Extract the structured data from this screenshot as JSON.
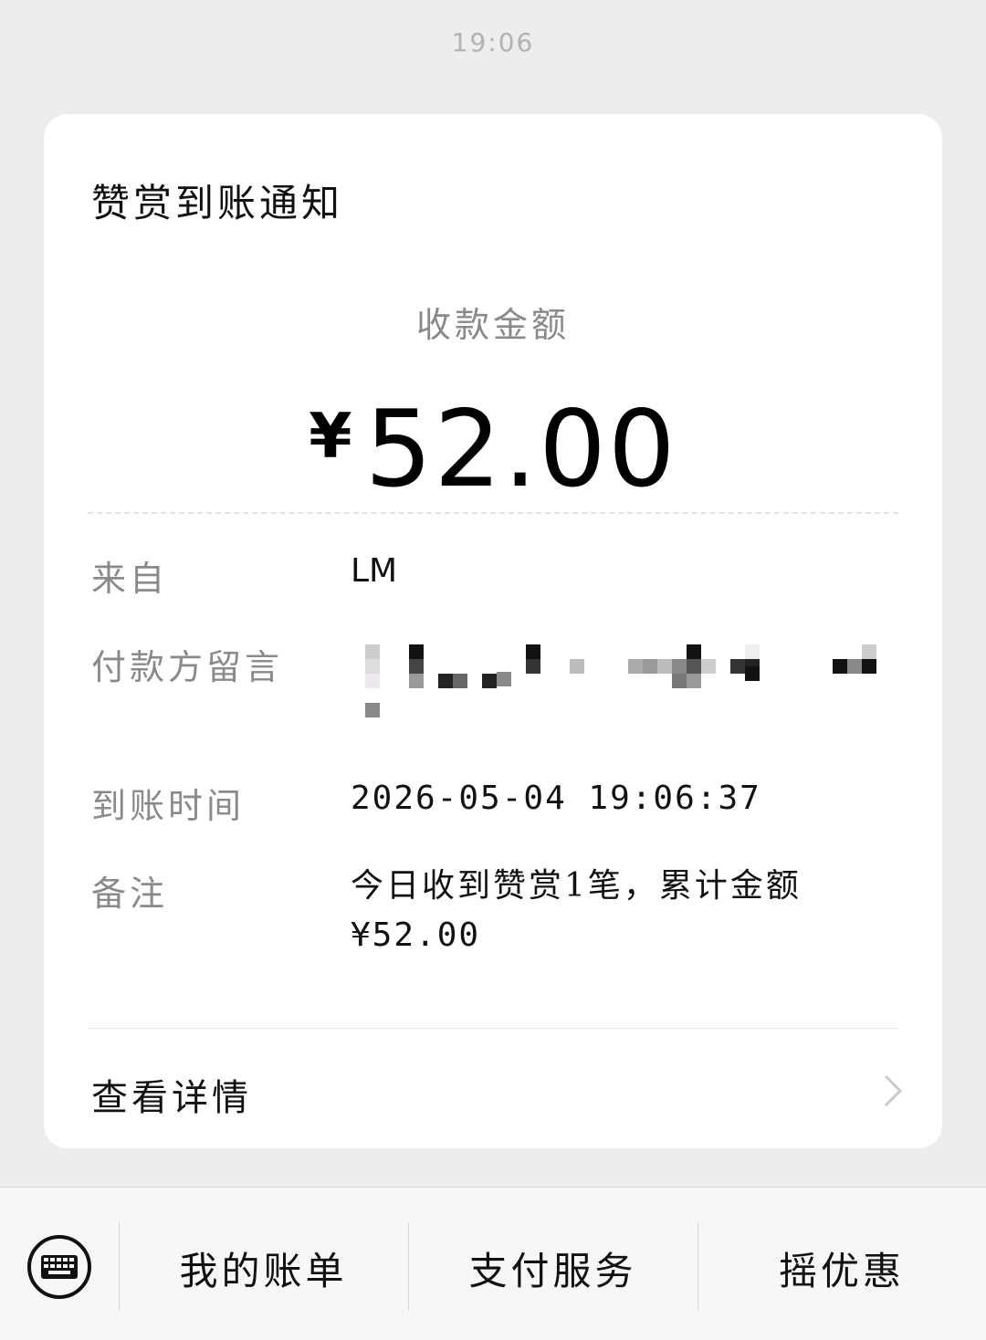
{
  "timestamp": "19:06",
  "card": {
    "title": "赞赏到账通知",
    "amount_label": "收款金额",
    "currency": "¥",
    "amount": "52.00",
    "rows": [
      {
        "label": "来自",
        "value": "LM"
      },
      {
        "label": "付款方留言",
        "value": ""
      },
      {
        "label": "到账时间",
        "value": "2026-05-04 19:06:37"
      },
      {
        "label": "备注",
        "value": "今日收到赞赏1笔，累计金额",
        "value2": "¥52.00"
      }
    ],
    "detail_label": "查看详情"
  },
  "bottom_menu": {
    "items": [
      "我的账单",
      "支付服务",
      "摇优惠"
    ]
  },
  "icons": {
    "keyboard": "keyboard-icon",
    "chevron": "chevron-right-icon"
  }
}
